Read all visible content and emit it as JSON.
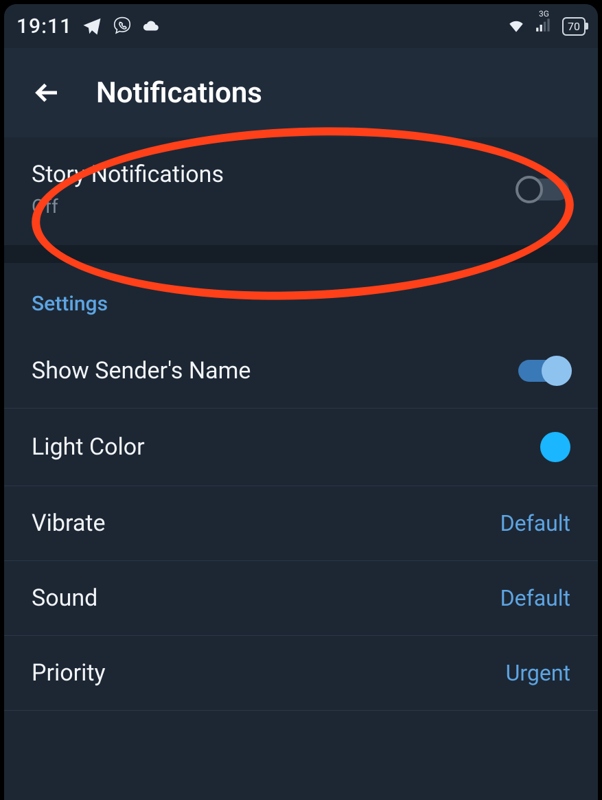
{
  "status": {
    "time": "19:11",
    "network_label": "3G",
    "battery_pct": "70"
  },
  "header": {
    "title": "Notifications"
  },
  "story": {
    "label": "Story Notifications",
    "state": "Off"
  },
  "settings": {
    "title": "Settings",
    "rows": {
      "sender": {
        "label": "Show Sender's Name"
      },
      "light": {
        "label": "Light Color",
        "swatch": "#1ab6ff"
      },
      "vibrate": {
        "label": "Vibrate",
        "value": "Default"
      },
      "sound": {
        "label": "Sound",
        "value": "Default"
      },
      "priority": {
        "label": "Priority",
        "value": "Urgent"
      }
    }
  }
}
